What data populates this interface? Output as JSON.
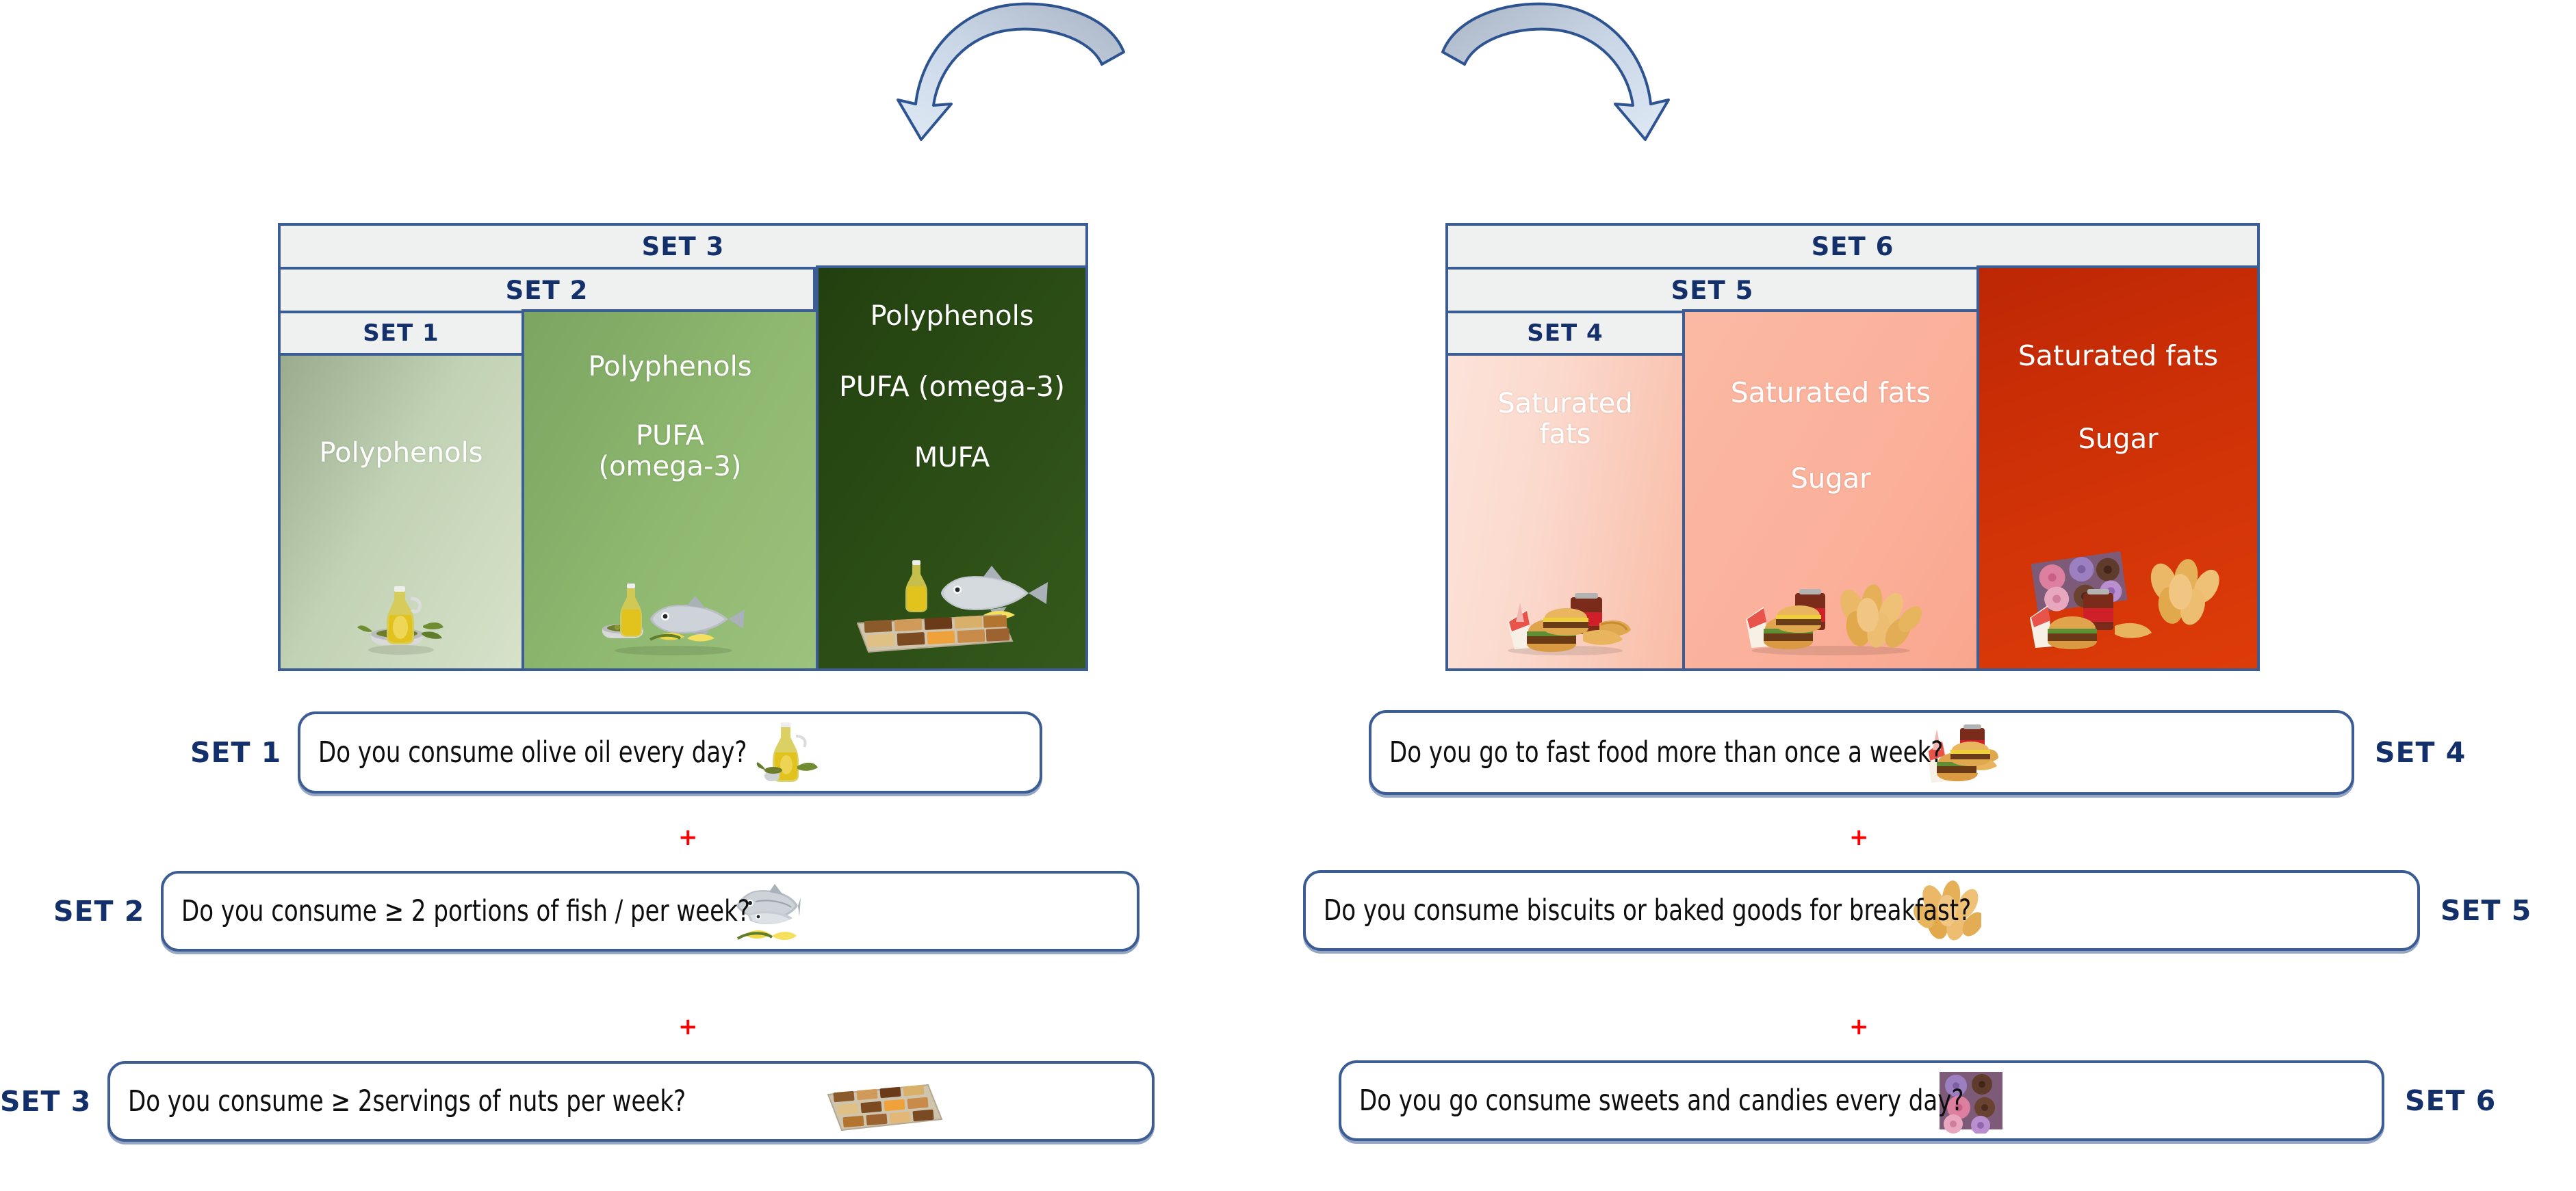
{
  "arrows": [
    {
      "name": "arrow-to-mediterranean-stack",
      "direction": "curve-down-left"
    },
    {
      "name": "arrow-to-western-stack",
      "direction": "curve-down-right"
    }
  ],
  "colors": {
    "border_blue": "#3c5c94",
    "label_navy": "#13306b",
    "band_fill": "#eff0f0",
    "plus_red": "#fe0000",
    "green_light": "#d6e2ca",
    "green_mid": "#8fb870",
    "green_dark": "#2c4e16",
    "red_light": "#fbd9cd",
    "red_mid": "#fbb09a",
    "red_dark": "#cf3107"
  },
  "mediterranean_stack": {
    "bands": [
      {
        "label": "SET 3"
      },
      {
        "label": "SET 2"
      },
      {
        "label": "SET 1"
      }
    ],
    "panels": [
      {
        "set": "SET 1",
        "nutrients": [
          "Polyphenols"
        ],
        "food_icon": "olive-oil-icon"
      },
      {
        "set": "SET 2",
        "nutrients": [
          "Polyphenols",
          "PUFA",
          "(omega-3)"
        ],
        "food_icon": "olive-oil-and-fish-icon"
      },
      {
        "set": "SET 3",
        "nutrients": [
          "Polyphenols",
          "PUFA (omega-3)",
          "MUFA"
        ],
        "food_icon": "olive-oil-fish-and-nuts-icon"
      }
    ]
  },
  "western_stack": {
    "bands": [
      {
        "label": "SET 6"
      },
      {
        "label": "SET 5"
      },
      {
        "label": "SET 4"
      }
    ],
    "panels": [
      {
        "set": "SET 4",
        "nutrients": [
          "Saturated",
          "fats"
        ],
        "food_icon": "fast-food-icon"
      },
      {
        "set": "SET 5",
        "nutrients": [
          "Saturated fats",
          "Sugar"
        ],
        "food_icon": "fast-food-and-biscuits-icon"
      },
      {
        "set": "SET 6",
        "nutrients": [
          "Saturated fats",
          "Sugar"
        ],
        "food_icon": "fast-food-biscuits-and-donuts-icon"
      }
    ]
  },
  "questions_left": [
    {
      "tag": "SET 1",
      "tag_side": "left",
      "text": "Do you consume olive oil every day?",
      "icon": "olive-oil-icon"
    },
    {
      "tag": "SET 2",
      "tag_side": "left",
      "text": "Do you consume ≥ 2 portions of fish / per week?",
      "icon": "fish-icon"
    },
    {
      "tag": "SET 3",
      "tag_side": "left",
      "text": "Do you consume ≥ 2servings of nuts per week?",
      "icon": "nuts-tray-icon"
    }
  ],
  "questions_right": [
    {
      "tag": "SET 4",
      "tag_side": "right",
      "text": "Do you go to fast food more than once a week?",
      "icon": "fast-food-icon"
    },
    {
      "tag": "SET 5",
      "tag_side": "right",
      "text": "Do you consume biscuits or baked goods for breakfast?",
      "icon": "biscuits-icon"
    },
    {
      "tag": "SET 6",
      "tag_side": "right",
      "text": "Do you go consume sweets and candies every day?",
      "icon": "donuts-icon"
    }
  ],
  "separators": {
    "symbol": "+",
    "count_per_column": 2
  }
}
